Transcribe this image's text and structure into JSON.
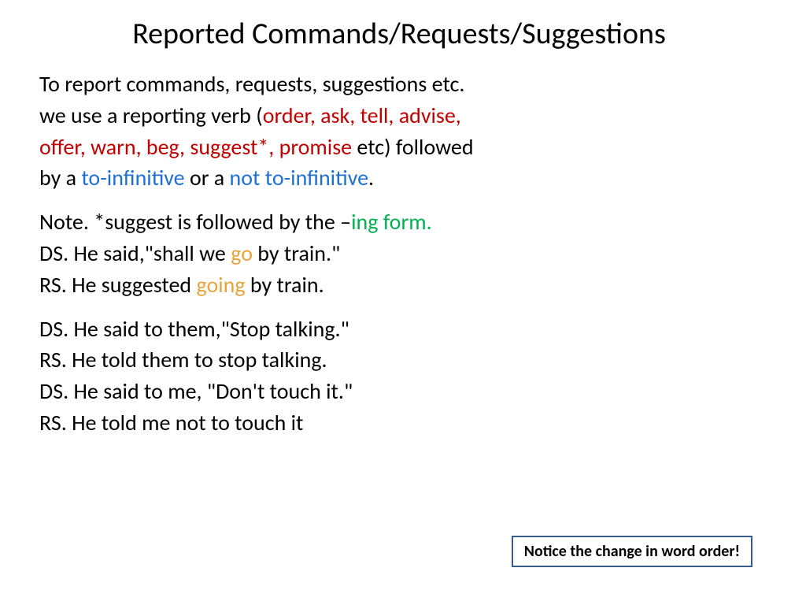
{
  "title": "Reported Commands/Requests/Suggestions",
  "intro": {
    "l1a": "To report commands, requests, suggestions etc.",
    "l2a": "we use a reporting verb (",
    "l2b": "order, ask, tell, advise,",
    "l3a": "offer, warn, beg, suggest*, promise",
    "l3b": " etc) followed",
    "l4a": "by a ",
    "l4b": "to-infinitive",
    "l4c": " or a ",
    "l4d": "not to-infinitive",
    "l4e": "."
  },
  "note": {
    "l1a": "Note. *suggest is followed by the –",
    "l1b": "ing form.",
    "l2a": "DS.  He said,\"shall we ",
    "l2b": "go",
    "l2c": " by train.\"",
    "l3a": "RS.  He suggested ",
    "l3b": "going",
    "l3c": " by train."
  },
  "examples": {
    "l1": "DS.  He said to them,\"Stop talking.\"",
    "l2": "RS.  He told them to stop talking.",
    "l3": "DS.  He said to me, \"Don't touch it.\"",
    "l4": "RS.    He told me not to touch it"
  },
  "callout": "Notice the change in word order!"
}
